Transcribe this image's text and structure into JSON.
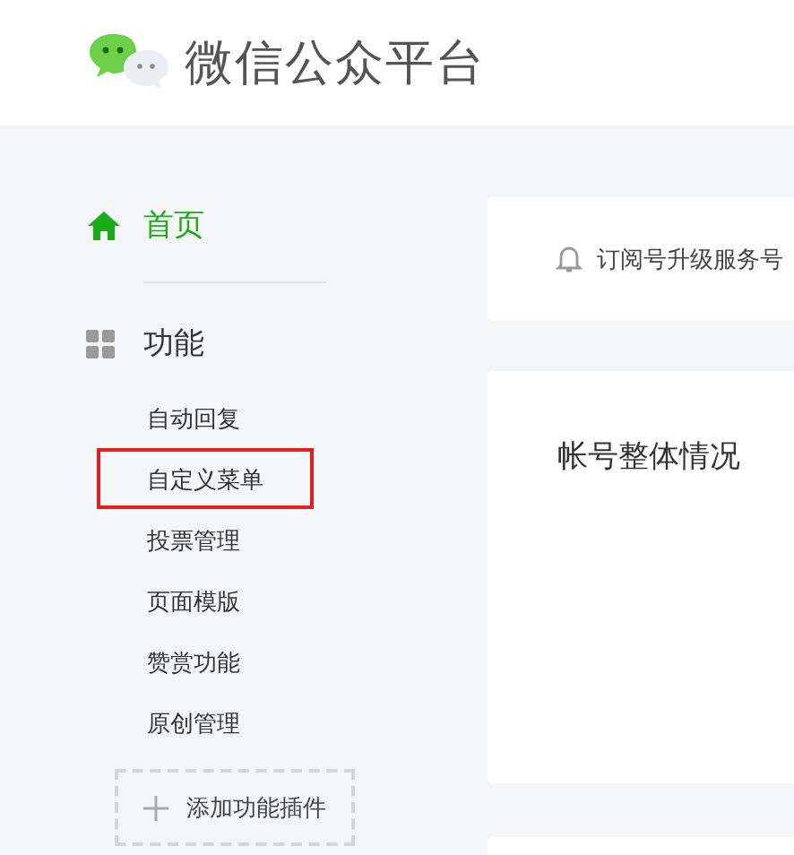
{
  "header": {
    "title": "微信公众平台"
  },
  "sidebar": {
    "home": {
      "label": "首页",
      "selected": true
    },
    "section": {
      "label": "功能"
    },
    "items": [
      {
        "label": "自动回复",
        "selected": false,
        "highlighted": false
      },
      {
        "label": "自定义菜单",
        "selected": false,
        "highlighted": true
      },
      {
        "label": "投票管理",
        "selected": false,
        "highlighted": false
      },
      {
        "label": "页面模版",
        "selected": false,
        "highlighted": false
      },
      {
        "label": "赞赏功能",
        "selected": false,
        "highlighted": false
      },
      {
        "label": "原创管理",
        "selected": false,
        "highlighted": false
      }
    ],
    "add_button": "添加功能插件"
  },
  "notice": {
    "text": "订阅号升级服务号"
  },
  "overview": {
    "title": "帐号整体情况"
  }
}
